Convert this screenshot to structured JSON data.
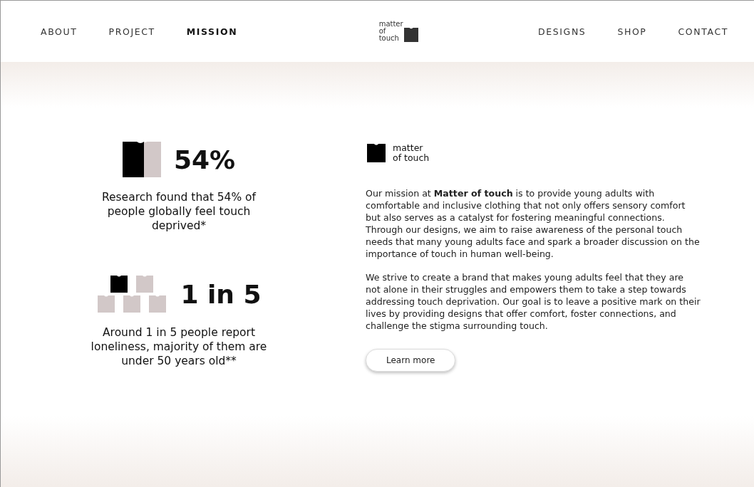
{
  "nav_left": [
    {
      "label": "ABOUT",
      "selected": false
    },
    {
      "label": "PROJECT",
      "selected": false
    },
    {
      "label": "MISSION",
      "selected": true
    }
  ],
  "logo": {
    "lines": [
      "matter",
      "of",
      "touch"
    ]
  },
  "nav_right": [
    {
      "label": "DESIGNS",
      "selected": false
    },
    {
      "label": "SHOP",
      "selected": false
    },
    {
      "label": "CONTACT",
      "selected": false
    }
  ],
  "stats": [
    {
      "kind": "split",
      "value": "54%",
      "text": "Research found that 54% of people globally feel touch deprived*"
    },
    {
      "kind": "group",
      "value": "1 in 5",
      "text": "Around 1 in 5 people report loneliness, majority of them are under 50 years old**"
    }
  ],
  "brand": {
    "lines": [
      "matter",
      "of touch"
    ]
  },
  "paragraphs": [
    "Our mission at **Matter of touch** is to provide young adults with comfortable and inclusive clothing that not only offers sensory comfort but also serves as a catalyst for fostering meaningful connections. Through our designs, we aim to raise awareness of the personal touch needs that many young adults face and spark a broader discussion on the importance of touch in human well-being.",
    "We strive to create a brand that makes young adults feel that they are not alone in their struggles and empowers them to take a step towards addressing touch deprivation. Our goal is to leave a positive mark on their lives by providing designs that offer comfort, foster connections, and challenge the stigma surrounding touch."
  ],
  "button": "Learn more"
}
